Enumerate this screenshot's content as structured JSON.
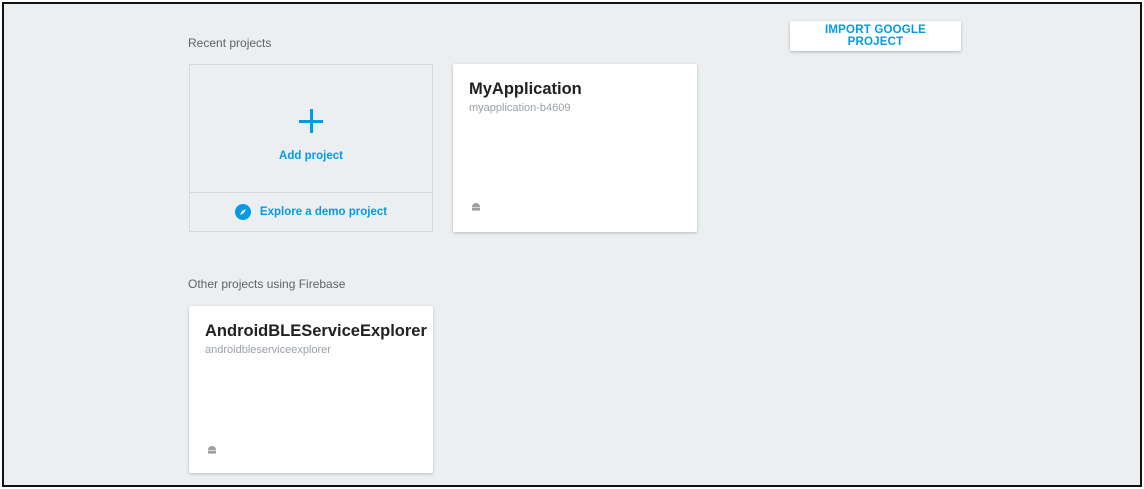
{
  "header": {
    "import_button_label": "IMPORT GOOGLE PROJECT"
  },
  "recent": {
    "section_label": "Recent projects",
    "add_project_label": "Add project",
    "explore_label": "Explore a demo project",
    "projects": [
      {
        "name": "MyApplication",
        "id": "myapplication-b4609",
        "platform_icon": "android-icon"
      }
    ]
  },
  "other": {
    "section_label": "Other projects using Firebase",
    "projects": [
      {
        "name": "AndroidBLEServiceExplorer",
        "id": "androidbleserviceexplorer",
        "platform_icon": "android-icon"
      }
    ]
  },
  "colors": {
    "accent": "#039be5",
    "background": "#eceff1",
    "card": "#ffffff",
    "title_text": "#212121",
    "sub_text": "#9aa0a6"
  }
}
